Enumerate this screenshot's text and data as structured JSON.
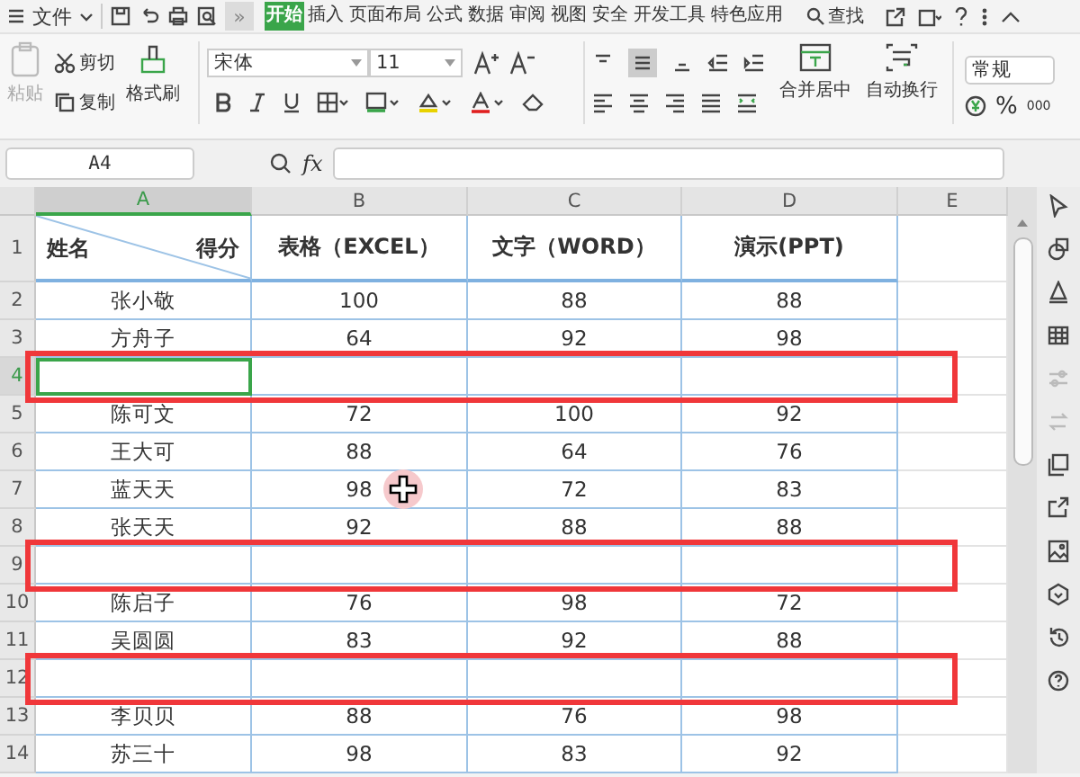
{
  "menu_bar": {
    "file_menu": "文件",
    "overflow": "»",
    "tabs": [
      {
        "label": "开始",
        "selected": true
      },
      {
        "label": "插入",
        "selected": false
      },
      {
        "label": "页面布局",
        "selected": false
      },
      {
        "label": "公式",
        "selected": false
      },
      {
        "label": "数据",
        "selected": false
      },
      {
        "label": "审阅",
        "selected": false
      },
      {
        "label": "视图",
        "selected": false
      },
      {
        "label": "安全",
        "selected": false
      },
      {
        "label": "开发工具",
        "selected": false
      },
      {
        "label": "特色应用",
        "selected": false
      }
    ],
    "search": "查找"
  },
  "ribbon": {
    "paste": {
      "label": "粘贴",
      "disabled": true
    },
    "cut": "剪切",
    "copy": "复制",
    "format_painter": "格式刷",
    "font_family": "宋体",
    "font_size": "11",
    "merge_center": "合并居中",
    "wrap_text": "自动换行",
    "number_format": "常规",
    "percent": "%",
    "thousands": "000"
  },
  "formula_bar": {
    "cell_ref": "A4",
    "fx": "fx"
  },
  "columns": [
    {
      "label": "A",
      "selected": true
    },
    {
      "label": "B",
      "selected": false
    },
    {
      "label": "C",
      "selected": false
    },
    {
      "label": "D",
      "selected": false
    },
    {
      "label": "E",
      "selected": false
    }
  ],
  "header_row": {
    "number": "1",
    "corner_left": "姓名",
    "corner_right": "得分",
    "cells": [
      "表格（EXCEL）",
      "文字（WORD）",
      "演示(PPT)"
    ]
  },
  "rows": [
    {
      "number": "2",
      "selected": false,
      "outlined": false,
      "cells": [
        "张小敬",
        "100",
        "88",
        "88"
      ]
    },
    {
      "number": "3",
      "selected": false,
      "outlined": false,
      "cells": [
        "方舟子",
        "64",
        "92",
        "98"
      ]
    },
    {
      "number": "4",
      "selected": true,
      "outlined": true,
      "cells": [
        "",
        "",
        "",
        ""
      ]
    },
    {
      "number": "5",
      "selected": false,
      "outlined": false,
      "cells": [
        "陈可文",
        "72",
        "100",
        "92"
      ]
    },
    {
      "number": "6",
      "selected": false,
      "outlined": false,
      "cells": [
        "王大可",
        "88",
        "64",
        "76"
      ]
    },
    {
      "number": "7",
      "selected": false,
      "outlined": false,
      "cells": [
        "蓝天天",
        "98",
        "72",
        "83"
      ]
    },
    {
      "number": "8",
      "selected": false,
      "outlined": false,
      "cells": [
        "张天天",
        "92",
        "88",
        "88"
      ]
    },
    {
      "number": "9",
      "selected": false,
      "outlined": true,
      "cells": [
        "",
        "",
        "",
        ""
      ]
    },
    {
      "number": "10",
      "selected": false,
      "outlined": false,
      "cells": [
        "陈启子",
        "76",
        "98",
        "72"
      ]
    },
    {
      "number": "11",
      "selected": false,
      "outlined": false,
      "cells": [
        "吴圆圆",
        "83",
        "92",
        "88"
      ]
    },
    {
      "number": "12",
      "selected": false,
      "outlined": true,
      "cells": [
        "",
        "",
        "",
        ""
      ]
    },
    {
      "number": "13",
      "selected": false,
      "outlined": false,
      "cells": [
        "李贝贝",
        "88",
        "76",
        "98"
      ]
    },
    {
      "number": "14",
      "selected": false,
      "outlined": false,
      "cells": [
        "苏三十",
        "98",
        "83",
        "92"
      ]
    }
  ]
}
